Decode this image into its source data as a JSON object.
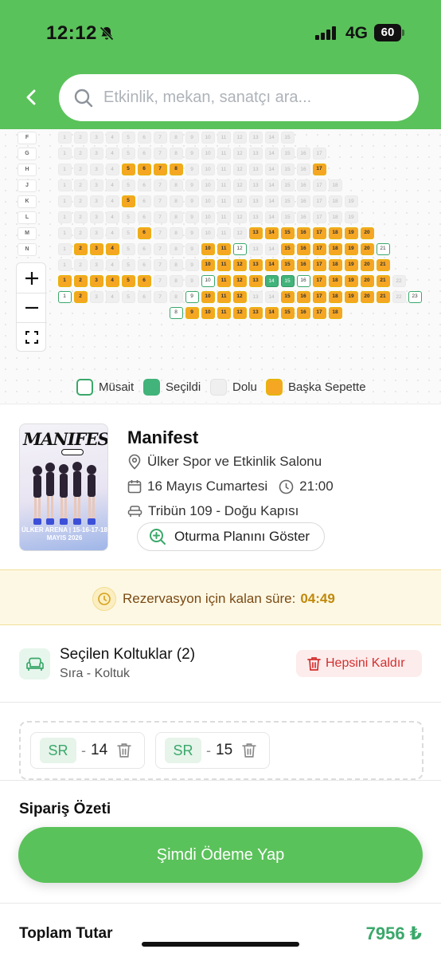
{
  "status_bar": {
    "time": "12:12",
    "network": "4G",
    "battery": "60"
  },
  "search": {
    "placeholder": "Etkinlik, mekan, sanatçı ara..."
  },
  "seatmap": {
    "rows": [
      {
        "label": "F",
        "seats": [
          [
            1,
            0
          ],
          [
            2,
            0
          ],
          [
            3,
            0
          ],
          [
            4,
            0
          ],
          [
            5,
            0
          ],
          [
            6,
            0
          ],
          [
            7,
            0
          ],
          [
            8,
            0
          ],
          [
            9,
            0
          ],
          [
            10,
            0
          ],
          [
            11,
            0
          ],
          [
            12,
            0
          ],
          [
            13,
            0
          ],
          [
            14,
            0
          ],
          [
            15,
            0
          ]
        ]
      },
      {
        "label": "G",
        "seats": [
          [
            1,
            0
          ],
          [
            2,
            0
          ],
          [
            3,
            0
          ],
          [
            4,
            0
          ],
          [
            5,
            0
          ],
          [
            6,
            0
          ],
          [
            7,
            0
          ],
          [
            8,
            0
          ],
          [
            9,
            0
          ],
          [
            10,
            0
          ],
          [
            11,
            0
          ],
          [
            12,
            0
          ],
          [
            13,
            0
          ],
          [
            14,
            0
          ],
          [
            15,
            0
          ],
          [
            16,
            0
          ],
          [
            17,
            0
          ]
        ]
      },
      {
        "label": "H",
        "seats": [
          [
            1,
            0
          ],
          [
            2,
            0
          ],
          [
            3,
            0
          ],
          [
            4,
            0
          ],
          [
            5,
            3
          ],
          [
            6,
            3
          ],
          [
            7,
            3
          ],
          [
            8,
            3
          ],
          [
            9,
            0
          ],
          [
            10,
            0
          ],
          [
            11,
            0
          ],
          [
            12,
            0
          ],
          [
            13,
            0
          ],
          [
            14,
            0
          ],
          [
            15,
            0
          ],
          [
            16,
            0
          ],
          [
            17,
            3
          ]
        ]
      },
      {
        "label": "J",
        "seats": [
          [
            1,
            0
          ],
          [
            2,
            0
          ],
          [
            3,
            0
          ],
          [
            4,
            0
          ],
          [
            5,
            0
          ],
          [
            6,
            0
          ],
          [
            7,
            0
          ],
          [
            8,
            0
          ],
          [
            9,
            0
          ],
          [
            10,
            0
          ],
          [
            11,
            0
          ],
          [
            12,
            0
          ],
          [
            13,
            0
          ],
          [
            14,
            0
          ],
          [
            15,
            0
          ],
          [
            16,
            0
          ],
          [
            17,
            0
          ],
          [
            18,
            0
          ]
        ]
      },
      {
        "label": "K",
        "seats": [
          [
            1,
            0
          ],
          [
            2,
            0
          ],
          [
            3,
            0
          ],
          [
            4,
            0
          ],
          [
            5,
            3
          ],
          [
            6,
            0
          ],
          [
            7,
            0
          ],
          [
            8,
            0
          ],
          [
            9,
            0
          ],
          [
            10,
            0
          ],
          [
            11,
            0
          ],
          [
            12,
            0
          ],
          [
            13,
            0
          ],
          [
            14,
            0
          ],
          [
            15,
            0
          ],
          [
            16,
            0
          ],
          [
            17,
            0
          ],
          [
            18,
            0
          ],
          [
            19,
            0
          ]
        ]
      },
      {
        "label": "L",
        "seats": [
          [
            1,
            0
          ],
          [
            2,
            0
          ],
          [
            3,
            0
          ],
          [
            4,
            0
          ],
          [
            5,
            0
          ],
          [
            6,
            0
          ],
          [
            7,
            0
          ],
          [
            8,
            0
          ],
          [
            9,
            0
          ],
          [
            10,
            0
          ],
          [
            11,
            0
          ],
          [
            12,
            0
          ],
          [
            13,
            0
          ],
          [
            14,
            0
          ],
          [
            15,
            0
          ],
          [
            16,
            0
          ],
          [
            17,
            0
          ],
          [
            18,
            0
          ],
          [
            19,
            0
          ]
        ]
      },
      {
        "label": "M",
        "seats": [
          [
            1,
            0
          ],
          [
            2,
            0
          ],
          [
            3,
            0
          ],
          [
            4,
            0
          ],
          [
            5,
            0
          ],
          [
            6,
            3
          ],
          [
            7,
            0
          ],
          [
            8,
            0
          ],
          [
            9,
            0
          ],
          [
            10,
            0
          ],
          [
            11,
            0
          ],
          [
            12,
            0
          ],
          [
            13,
            3
          ],
          [
            14,
            3
          ],
          [
            15,
            3
          ],
          [
            16,
            3
          ],
          [
            17,
            3
          ],
          [
            18,
            3
          ],
          [
            19,
            3
          ],
          [
            20,
            3
          ]
        ]
      },
      {
        "label": "N",
        "seats": [
          [
            1,
            0
          ],
          [
            2,
            3
          ],
          [
            3,
            3
          ],
          [
            4,
            3
          ],
          [
            5,
            0
          ],
          [
            6,
            0
          ],
          [
            7,
            0
          ],
          [
            8,
            0
          ],
          [
            9,
            0
          ],
          [
            10,
            3
          ],
          [
            11,
            3
          ],
          [
            12,
            1
          ],
          [
            13,
            0
          ],
          [
            14,
            0
          ],
          [
            15,
            3
          ],
          [
            16,
            3
          ],
          [
            17,
            3
          ],
          [
            18,
            3
          ],
          [
            19,
            3
          ],
          [
            20,
            3
          ],
          [
            21,
            1
          ]
        ]
      },
      {
        "label": "",
        "seats": [
          [
            1,
            0
          ],
          [
            2,
            0
          ],
          [
            3,
            0
          ],
          [
            4,
            0
          ],
          [
            5,
            0
          ],
          [
            6,
            0
          ],
          [
            7,
            0
          ],
          [
            8,
            0
          ],
          [
            9,
            0
          ],
          [
            10,
            3
          ],
          [
            11,
            3
          ],
          [
            12,
            3
          ],
          [
            13,
            3
          ],
          [
            14,
            3
          ],
          [
            15,
            3
          ],
          [
            16,
            3
          ],
          [
            17,
            3
          ],
          [
            18,
            3
          ],
          [
            19,
            3
          ],
          [
            20,
            3
          ],
          [
            21,
            3
          ]
        ]
      },
      {
        "label": "",
        "seats": [
          [
            1,
            3
          ],
          [
            2,
            3
          ],
          [
            3,
            3
          ],
          [
            4,
            3
          ],
          [
            5,
            3
          ],
          [
            6,
            3
          ],
          [
            7,
            0
          ],
          [
            8,
            0
          ],
          [
            9,
            0
          ],
          [
            10,
            1
          ],
          [
            11,
            3
          ],
          [
            12,
            3
          ],
          [
            13,
            3
          ],
          [
            14,
            2
          ],
          [
            15,
            2
          ],
          [
            16,
            1
          ],
          [
            17,
            3
          ],
          [
            18,
            3
          ],
          [
            19,
            3
          ],
          [
            20,
            3
          ],
          [
            21,
            3
          ],
          [
            22,
            0
          ]
        ]
      },
      {
        "label": "",
        "seats": [
          [
            1,
            1
          ],
          [
            2,
            3
          ],
          [
            3,
            0
          ],
          [
            4,
            0
          ],
          [
            5,
            0
          ],
          [
            6,
            0
          ],
          [
            7,
            0
          ],
          [
            8,
            0
          ],
          [
            9,
            1
          ],
          [
            10,
            3
          ],
          [
            11,
            3
          ],
          [
            12,
            3
          ],
          [
            13,
            0
          ],
          [
            14,
            0
          ],
          [
            15,
            3
          ],
          [
            16,
            3
          ],
          [
            17,
            3
          ],
          [
            18,
            3
          ],
          [
            19,
            3
          ],
          [
            20,
            3
          ],
          [
            21,
            3
          ],
          [
            22,
            0
          ],
          [
            23,
            1
          ]
        ]
      },
      {
        "label": "",
        "seats": [
          [
            8,
            1
          ],
          [
            9,
            3
          ],
          [
            10,
            3
          ],
          [
            11,
            3
          ],
          [
            12,
            3
          ],
          [
            13,
            3
          ],
          [
            14,
            3
          ],
          [
            15,
            3
          ],
          [
            16,
            3
          ],
          [
            17,
            3
          ],
          [
            18,
            3
          ]
        ]
      }
    ],
    "legend": [
      {
        "label": "Müsait",
        "color": "#ffffff",
        "border": "#3aa86a"
      },
      {
        "label": "Seçildi",
        "color": "#42b37a",
        "border": "#42b37a"
      },
      {
        "label": "Dolu",
        "color": "#efefef",
        "border": "#efefef"
      },
      {
        "label": "Başka Sepette",
        "color": "#f5a623",
        "border": "#e7b40a"
      }
    ]
  },
  "event": {
    "poster_title": "MANIFEST",
    "poster_subtitle": "ÜLKER ARENA | 15-16-17-18 MAYIS 2026",
    "title": "Manifest",
    "venue": "Ülker Spor ve Etkinlik Salonu",
    "date": "16 Mayıs Cumartesi",
    "time": "21:00",
    "section": "Tribün 109 - Doğu Kapısı",
    "plan_button": "Oturma Planını Göster"
  },
  "timer": {
    "label": "Rezervasyon için kalan süre:",
    "value": "04:49"
  },
  "selected": {
    "title": "Seçilen Koltuklar (2)",
    "subtitle": "Sıra - Koltuk",
    "remove_all": "Hepsini Kaldır",
    "seats": [
      {
        "row": "SR",
        "number": "14"
      },
      {
        "row": "SR",
        "number": "15"
      }
    ]
  },
  "summary": {
    "title": "Sipariş Özeti",
    "pay_button": "Şimdi Ödeme Yap",
    "total_label": "Toplam Tutar",
    "total_value": "7956 ₺"
  },
  "colors": {
    "brand_green": "#5ac25a",
    "taken": "#f5a623",
    "selected": "#42b37a",
    "danger": "#d32f2f"
  }
}
